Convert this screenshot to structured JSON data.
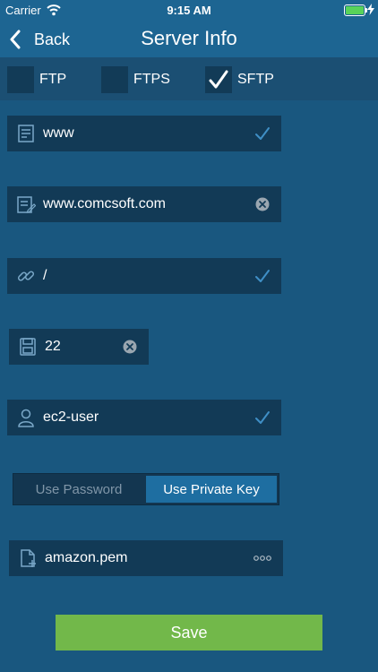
{
  "status_bar": {
    "carrier": "Carrier",
    "time": "9:15 AM"
  },
  "nav": {
    "back_label": "Back",
    "title": "Server Info"
  },
  "protocols": [
    {
      "label": "FTP",
      "checked": false
    },
    {
      "label": "FTPS",
      "checked": false
    },
    {
      "label": "SFTP",
      "checked": true
    }
  ],
  "fields": {
    "name": {
      "value": "www",
      "icon": "server-name-icon",
      "trailing": "checkmark-icon"
    },
    "host": {
      "value": "www.comcsoft.com",
      "icon": "host-icon",
      "trailing": "clear-icon"
    },
    "path": {
      "value": "/",
      "icon": "link-icon",
      "trailing": "checkmark-icon"
    },
    "port": {
      "value": "22",
      "icon": "port-icon",
      "trailing": "clear-icon"
    },
    "user": {
      "value": "ec2-user",
      "icon": "user-icon",
      "trailing": "checkmark-icon"
    },
    "key_file": {
      "value": "amazon.pem",
      "icon": "add-file-icon",
      "trailing": "more-options-icon"
    }
  },
  "auth": {
    "password_label": "Use Password",
    "key_label": "Use Private Key",
    "selected": "key"
  },
  "save_label": "Save",
  "colors": {
    "background": "#19577f",
    "nav": "#1d6592",
    "field": "#123a56",
    "accent": "#1e6ea1",
    "save": "#72b84a",
    "battery": "#58d35a"
  }
}
